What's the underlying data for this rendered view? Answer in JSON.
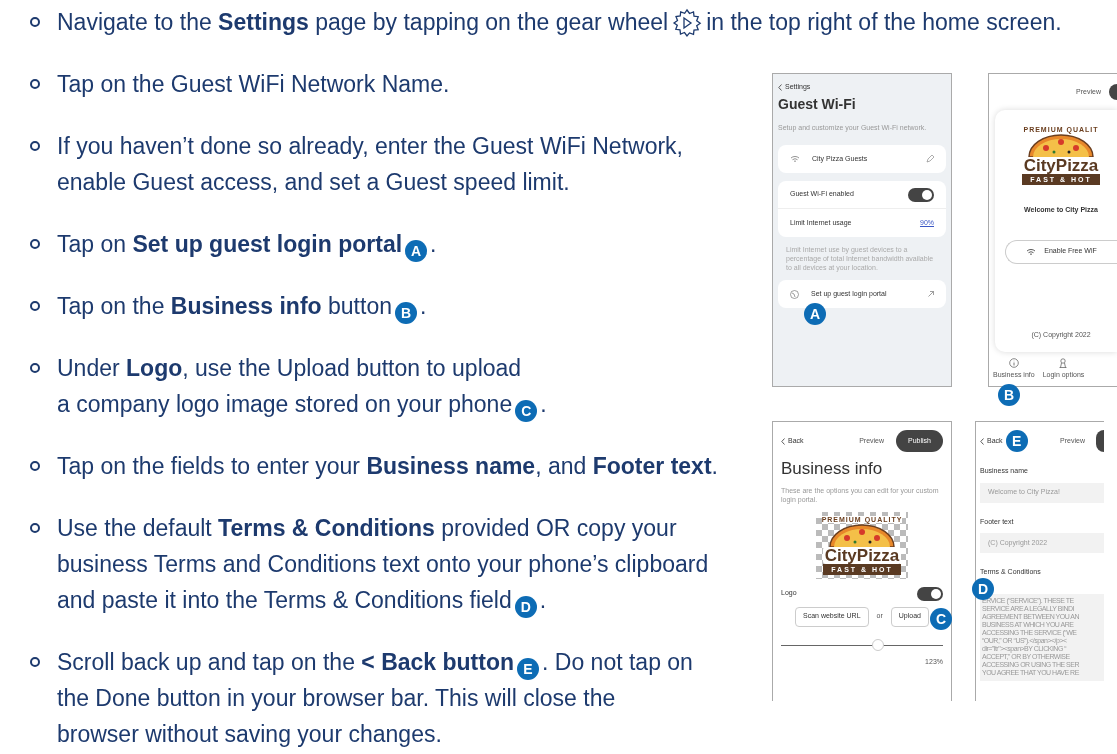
{
  "steps": [
    {
      "parts": [
        {
          "kind": "text",
          "text": "Navigate to the **Settings** page by tapping on the gear wheel"
        },
        {
          "kind": "icon"
        },
        {
          "kind": "text",
          "text": "in the top right of the home screen."
        }
      ]
    },
    {
      "parts": [
        {
          "kind": "text",
          "text": "Tap on the Guest WiFi Network Name."
        }
      ]
    },
    {
      "parts": [
        {
          "kind": "text",
          "text": "If you haven’t done so already, enter the Guest WiFi Network,\nenable Guest access, and set a Guest speed limit."
        }
      ]
    },
    {
      "parts": [
        {
          "kind": "text",
          "text": "Tap on **Set up guest login portal**"
        },
        {
          "kind": "badge",
          "text": "A"
        },
        {
          "kind": "text",
          "text": "."
        }
      ]
    },
    {
      "parts": [
        {
          "kind": "text",
          "text": "Tap on the **Business info** button"
        },
        {
          "kind": "badge",
          "text": "B"
        },
        {
          "kind": "text",
          "text": "."
        }
      ]
    },
    {
      "parts": [
        {
          "kind": "text",
          "text": "Under **Logo**, use the Upload button to upload\na company logo image stored on your phone"
        },
        {
          "kind": "badge",
          "text": "C"
        },
        {
          "kind": "text",
          "text": "."
        }
      ]
    },
    {
      "parts": [
        {
          "kind": "text",
          "text": "Tap on the fields to enter your **Business name**, and **Footer text**."
        }
      ]
    },
    {
      "parts": [
        {
          "kind": "text",
          "text": "Use the default **Terms & Conditions** provided OR copy your\nbusiness Terms and Conditions text onto your phone’s clipboard\nand paste it into the Terms & Conditions field"
        },
        {
          "kind": "badge",
          "text": "D"
        },
        {
          "kind": "text",
          "text": "."
        }
      ]
    },
    {
      "parts": [
        {
          "kind": "text",
          "text": "Scroll back up and tap on the **< Back button**"
        },
        {
          "kind": "badge",
          "text": "E"
        },
        {
          "kind": "text",
          "text": ". Do not tap on\nthe Done button in your browser bar.  This will close the\nbrowser without saving your changes."
        }
      ]
    }
  ],
  "guest_wifi": {
    "back": "Settings",
    "title": "Guest Wi-Fi",
    "subtitle": "Setup and customize your Guest Wi-Fi network.",
    "network": "City Pizza Guests",
    "toggle_label": "Guest Wi-Fi enabled",
    "toggle_on": true,
    "limit_label": "Limit Internet usage",
    "limit_value": "90%",
    "note": "Limit Internet use by guest devices to a percentage of total Internet bandwidth available to all devices at your location.",
    "portal": "Set up guest login portal",
    "badge": "A"
  },
  "portal_preview": {
    "preview": "Preview",
    "logo": {
      "top": "PREMIUM QUALIT",
      "name": "CityPizza",
      "tagline": "FAST & HOT"
    },
    "welcome": "Welcome to City Pizza",
    "wifi_button": "Enable Free WiF",
    "footer": "(C) Copyright 2022",
    "tabs": [
      {
        "kind": "info",
        "label": "Business info"
      },
      {
        "kind": "person",
        "label": "Login options"
      }
    ],
    "badge": "B"
  },
  "business_info": {
    "back": "Back",
    "preview": "Preview",
    "publish": "Publish",
    "title": "Business info",
    "description": "These are the options you can edit for your custom login portal.",
    "logo": {
      "top": "PREMIUM QUALITY",
      "name": "CityPizza",
      "tagline": "FAST & HOT"
    },
    "logo_label": "Logo",
    "logo_on": true,
    "scan_button": "Scan website URL",
    "or": "or",
    "upload_button": "Upload",
    "badge": "C",
    "slider": {
      "level": 0.6,
      "reading": "123%"
    }
  },
  "business_fields": {
    "back": "Back",
    "badge_back": "E",
    "preview": "Preview",
    "fields": [
      {
        "label": "Business name",
        "value": "Welcome to City Pizza!"
      },
      {
        "label": "Footer text",
        "value": "(C) Copyright 2022"
      }
    ],
    "terms_label": "Terms & Conditions",
    "terms": "ERVICE (“SERVICE”). THESE TE\nSERVICE ARE A LEGALLY BINDI\nAGREEMENT BETWEEN YOU AN\nBUSINESS AT WHICH YOU ARE\nACCESSING THE SERVICE (“WE\n“OUR,” OR “US”).</span></p><\ndir=\"ltr\"><span>BY CLICKING “\nACCEPT,” OR BY OTHERWISE\nACCESSING OR USING THE SER\nYOU AGREE THAT YOU HAVE RE",
    "badge_terms": "D"
  }
}
